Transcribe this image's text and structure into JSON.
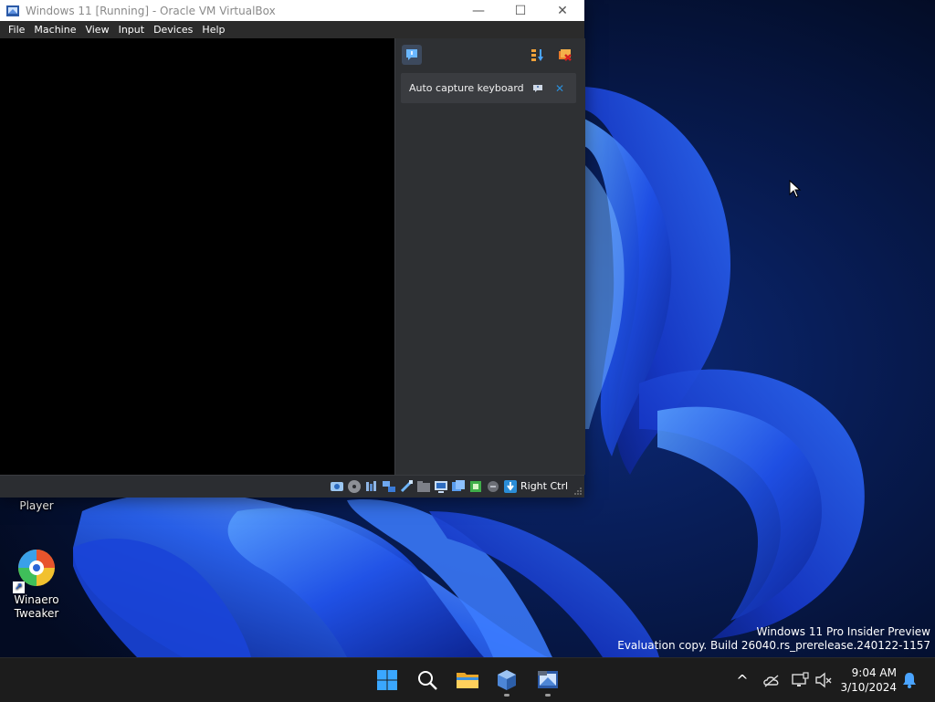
{
  "window": {
    "title": "Windows 11 [Running] - Oracle VM VirtualBox",
    "controls": {
      "minimize": "—",
      "maximize": "☐",
      "close": "✕"
    }
  },
  "menu": {
    "items": [
      "File",
      "Machine",
      "View",
      "Input",
      "Devices",
      "Help"
    ]
  },
  "notification_center": {
    "buttons": [
      "messages-toggle-icon",
      "sort-icon",
      "clear-all-icon"
    ],
    "notices": [
      {
        "text": "Auto capture keyboard ...",
        "help_icon": "help-icon",
        "close_icon": "close-icon"
      }
    ]
  },
  "statusbar": {
    "icons": [
      "hard-disk-icon",
      "optical-drive-icon",
      "audio-icon",
      "network-icon",
      "usb-icon",
      "shared-folders-icon",
      "display-icon",
      "recording-icon",
      "cpu-icon",
      "mouse-integration-icon",
      "keyboard-capture-icon"
    ],
    "host_key": "Right Ctrl"
  },
  "desktop": {
    "icons": [
      {
        "label": "Roblox Player"
      },
      {
        "label_line1": "Winaero",
        "label_line2": "Tweaker"
      }
    ],
    "watermark": {
      "line1": "Windows 11 Pro Insider Preview",
      "line2": "Evaluation copy. Build 26040.rs_prerelease.240122-1157"
    }
  },
  "taskbar": {
    "apps": [
      "start-icon",
      "search-icon",
      "file-explorer-icon",
      "virtualbox-icon",
      "virtualbox-vm-icon"
    ],
    "tray": {
      "chevron": "^",
      "icons": [
        "onedrive-icon",
        "network-icon",
        "volume-muted-icon"
      ],
      "time": "9:04 AM",
      "date": "3/10/2024"
    }
  },
  "colors": {
    "accent": "#2a8dd8",
    "taskbar_bg": "#1c1c1c",
    "wallpaper_dark": "#05122e",
    "wallpaper_blue": "#1f4fe0"
  }
}
